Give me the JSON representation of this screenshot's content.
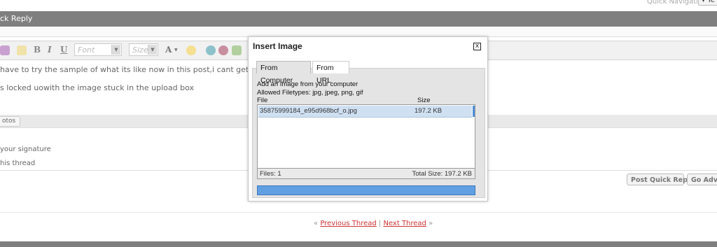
{
  "quick_nav": {
    "label": "Quick Navigation",
    "button": "▾ Te"
  },
  "quick_reply": {
    "title": "ck Reply"
  },
  "toolbar": {
    "bold": "B",
    "italic": "I",
    "underline": "U",
    "font_placeholder": "Font",
    "size_placeholder": "Size",
    "color_label": "A"
  },
  "editor": {
    "line1": "have to try the sample of what its like now in this post,i cant get tw",
    "line2": "s locked uowith the image stuck in the upload box"
  },
  "attach": {
    "label": "otos"
  },
  "options": {
    "signature": "your signature",
    "thread": "his thread"
  },
  "buttons": {
    "post_quick_reply": "Post Quick Reply",
    "go_advanced": "Go Advanced"
  },
  "thread_nav": {
    "prev": "Previous Thread",
    "next": "Next Thread",
    "sep": "|",
    "left_q": "«",
    "right_q": "»"
  },
  "dialog": {
    "title": "Insert Image",
    "close": "x",
    "tabs": [
      "From Computer",
      "From URL"
    ],
    "instructions": "Add an Image from your computer",
    "filetypes": "Allowed Filetypes: jpg, jpeg, png, gif",
    "col_file": "File",
    "col_size": "Size",
    "files": [
      {
        "name": "35875999184_e95d968bcf_o.jpg",
        "size": "197.2 KB"
      }
    ],
    "files_count": "Files: 1",
    "total_size": "Total Size: 197.2 KB"
  },
  "colors": {
    "header_band": "#7f7f7f",
    "progress": "#5f9fe2",
    "selected_row": "#cfe0f2",
    "link": "#cc3333"
  }
}
